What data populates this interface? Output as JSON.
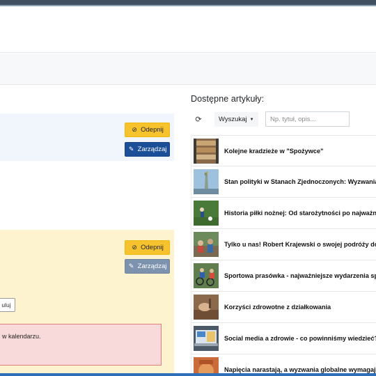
{
  "left": {
    "card1": {
      "unpin_label": "Odepnij",
      "manage_label": "Zarządzaj"
    },
    "card2": {
      "unpin_label": "Odepnij",
      "manage_label": "Zarządzaj",
      "partial_button_label": "uluj"
    },
    "alert": {
      "text": "w kalendarzu."
    }
  },
  "right": {
    "title": "Dostępne artykuły:",
    "search": {
      "dropdown_label": "Wyszukaj",
      "placeholder": "Np. tytuł, opis..."
    },
    "articles": [
      {
        "title": "Kolejne kradzieże w \"Spożywce\"",
        "thumb": "shelves"
      },
      {
        "title": "Stan polityki w Stanach Zjednoczonych: Wyzwania i",
        "thumb": "statue"
      },
      {
        "title": "Historia piłki nożnej: Od starożytności po najważnie",
        "thumb": "football"
      },
      {
        "title": "Tylko u nas! Robert Krajewski o swojej podróży do",
        "thumb": "travel"
      },
      {
        "title": "Sportowa prasówka - najważniejsze wydarzenia spo",
        "thumb": "cyclists"
      },
      {
        "title": "Korzyści zdrowotne z działkowania",
        "thumb": "garden"
      },
      {
        "title": "Social media a zdrowie - co powinniśmy wiedzieć?",
        "thumb": "laptop"
      },
      {
        "title": "Napięcia narastają, a wyzwania globalne wymagają",
        "thumb": "globe"
      }
    ]
  },
  "colors": {
    "warning": "#f6c22e",
    "primary": "#1b4f98",
    "muted": "#7d92ad",
    "alert_bg": "#f9dada",
    "alert_border": "#e07c7c",
    "highlight_blue": "#f1f6fd",
    "highlight_yellow": "#fdf3cf"
  }
}
